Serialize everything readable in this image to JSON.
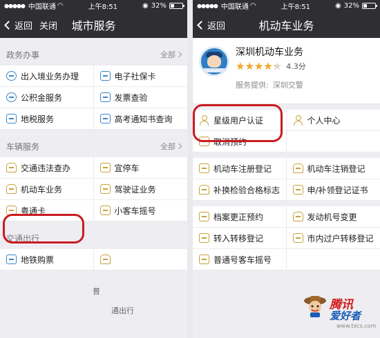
{
  "colors": {
    "nav_bg": "#2e2e33",
    "accent_gold": "#c7a13b",
    "accent_blue": "#3a86c6",
    "highlight_red": "#c91b1f",
    "star": "#f5a623"
  },
  "left": {
    "status": {
      "carrier": "中国联通",
      "time": "上午8:51",
      "battery": "32%"
    },
    "nav": {
      "back": "返回",
      "close": "关闭",
      "title": "城市服务"
    },
    "sections": [
      {
        "title": "政务办事",
        "all": "全部",
        "items": [
          {
            "label": "出入境业务办理",
            "icon": "globe-icon"
          },
          {
            "label": "电子社保卡",
            "icon": "id-card-icon"
          },
          {
            "label": "公积金服务",
            "icon": "piggy-bank-icon"
          },
          {
            "label": "发票查验",
            "icon": "invoice-icon"
          },
          {
            "label": "地税服务",
            "icon": "document-icon"
          },
          {
            "label": "高考通知书查询",
            "icon": "search-doc-icon"
          }
        ]
      },
      {
        "title": "车辆服务",
        "all": "全部",
        "items": [
          {
            "label": "交通违法查办",
            "icon": "car-warning-icon"
          },
          {
            "label": "宜停车",
            "icon": "parking-icon"
          },
          {
            "label": "机动车业务",
            "icon": "car-icon"
          },
          {
            "label": "驾驶证业务",
            "icon": "license-icon"
          },
          {
            "label": "粤通卡",
            "icon": "card-icon"
          },
          {
            "label": "小客车摇号",
            "icon": "lottery-icon"
          }
        ]
      },
      {
        "title": "交通出行",
        "items": [
          {
            "label": "地铁购票",
            "icon": "subway-icon"
          },
          {
            "label": "",
            "icon": "bus-icon"
          }
        ]
      }
    ],
    "ghost_text": {
      "a": "普",
      "b": "通出行"
    }
  },
  "right": {
    "status": {
      "carrier": "中国联通",
      "time": "上午8:51",
      "battery": "32%"
    },
    "nav": {
      "back": "返回",
      "title": "机动车业务"
    },
    "app": {
      "name": "深圳机动车业务",
      "rating": 4.3,
      "rating_text": "4.3分",
      "stars": "★★★★★",
      "provider_label": "服务提供:",
      "provider": "深圳交警"
    },
    "groups": [
      [
        {
          "label": "星级用户认证",
          "icon": "user-icon"
        },
        {
          "label": "个人中心",
          "icon": "user-icon"
        },
        {
          "label": "取消预约",
          "icon": "cancel-doc-icon"
        }
      ],
      [
        {
          "label": "机动车注册登记",
          "icon": "register-car-icon"
        },
        {
          "label": "机动车注销登记",
          "icon": "deregister-car-icon"
        },
        {
          "label": "补换检验合格标志",
          "icon": "car-sticker-icon"
        },
        {
          "label": "申/补领登记证书",
          "icon": "certificate-icon"
        }
      ],
      [
        {
          "label": "档案更正预约",
          "icon": "calendar-icon"
        },
        {
          "label": "发动机号变更",
          "icon": "engine-icon"
        },
        {
          "label": "转入转移登记",
          "icon": "transfer-in-icon"
        },
        {
          "label": "市内过户转移登记",
          "icon": "transfer-icon"
        },
        {
          "label": "普通号客车摇号",
          "icon": "lottery-doc-icon"
        },
        {
          "label": "",
          "icon": ""
        }
      ]
    ]
  },
  "watermark": {
    "title": "腾讯",
    "subtitle": "爱好者",
    "url": "www.txcs.com"
  }
}
